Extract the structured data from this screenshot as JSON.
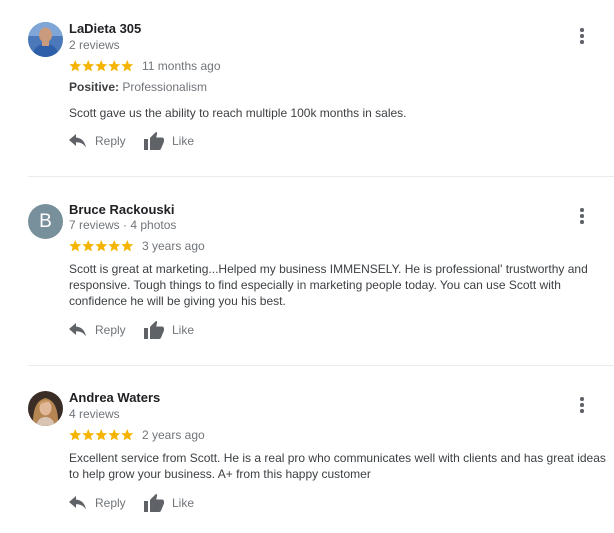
{
  "reviews": [
    {
      "name": "LaDieta 305",
      "meta": "2 reviews",
      "rating": 5,
      "date": "11 months ago",
      "positive_label": "Positive:",
      "positive_value": "Professionalism",
      "text": "Scott gave us the ability to reach multiple 100k months in sales.",
      "reply_label": "Reply",
      "like_label": "Like"
    },
    {
      "name": "Bruce Rackouski",
      "avatar_letter": "B",
      "meta": "7 reviews · 4 photos",
      "rating": 5,
      "date": "3 years ago",
      "text": "Scott is great at marketing...Helped my business IMMENSELY. He is professional' trustworthy and responsive. Tough  things to find especially in marketing people today. You can use Scott with confidence he will be giving you his best.",
      "reply_label": "Reply",
      "like_label": "Like"
    },
    {
      "name": "Andrea Waters",
      "meta": "4 reviews",
      "rating": 5,
      "date": "2 years ago",
      "text": "Excellent service from Scott. He is a real pro who communicates well with clients and has great ideas to help grow your business. A+ from this happy customer",
      "reply_label": "Reply",
      "like_label": "Like"
    }
  ],
  "colors": {
    "star": "#f4b400",
    "letter_avatar_bg": "#78909c",
    "icon_gray": "#5f6368",
    "secondary_text": "#70757a"
  },
  "icons": [
    "star-icon",
    "reply-icon",
    "thumbs-up-icon",
    "more-options-icon"
  ]
}
